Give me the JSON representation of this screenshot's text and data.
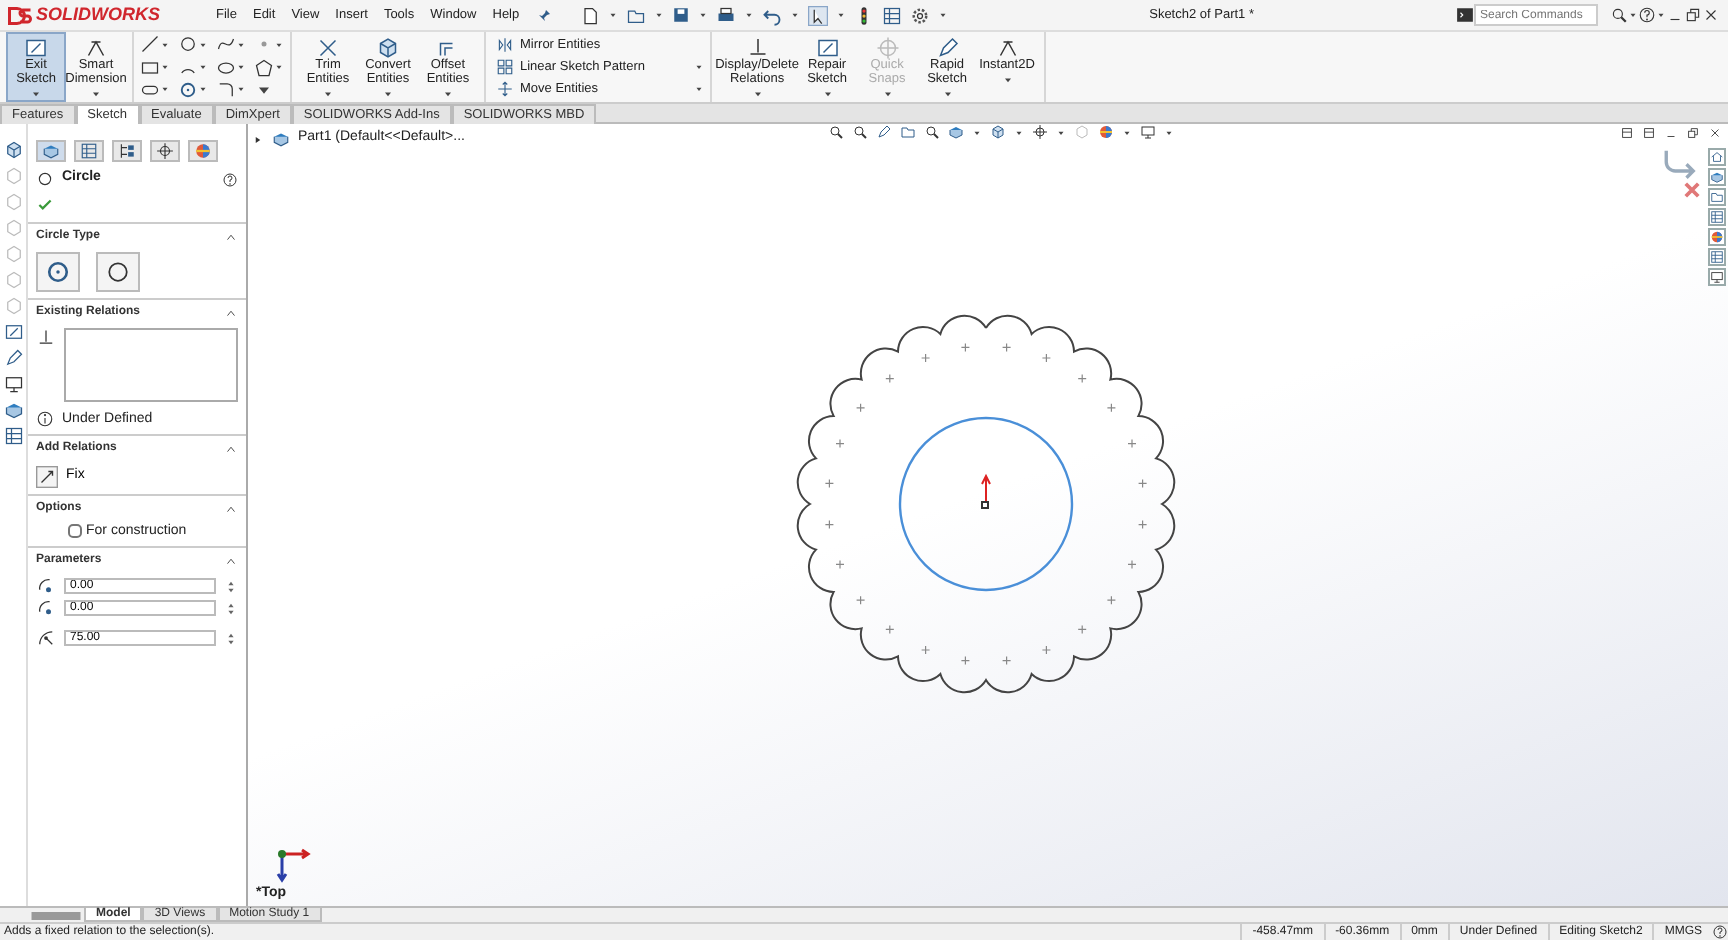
{
  "title_bar": {
    "logo": "SOLIDWORKS",
    "menus": [
      "File",
      "Edit",
      "View",
      "Insert",
      "Tools",
      "Window",
      "Help"
    ],
    "document_title": "Sketch2 of Part1 *",
    "search": {
      "placeholder": "Search Commands"
    }
  },
  "ribbon": {
    "left": [
      {
        "label": "Exit Sketch",
        "selected": true,
        "disabled": false
      },
      {
        "label": "Smart Dimension",
        "selected": false,
        "disabled": false
      }
    ],
    "middle": [
      {
        "label": "Trim Entities",
        "selected": false,
        "disabled": false
      },
      {
        "label": "Convert Entities",
        "selected": false,
        "disabled": false
      },
      {
        "label": "Offset Entities",
        "selected": false,
        "disabled": false
      }
    ],
    "stack": [
      "Mirror Entities",
      "Linear Sketch Pattern",
      "Move Entities"
    ],
    "right": [
      {
        "label": "Display/Delete Relations",
        "selected": false,
        "disabled": false
      },
      {
        "label": "Repair Sketch",
        "selected": false,
        "disabled": false
      },
      {
        "label": "Quick Snaps",
        "selected": false,
        "disabled": true
      },
      {
        "label": "Rapid Sketch",
        "selected": false,
        "disabled": false
      },
      {
        "label": "Instant2D",
        "selected": false,
        "disabled": false
      }
    ]
  },
  "command_tabs": [
    {
      "label": "Features",
      "selected": false
    },
    {
      "label": "Sketch",
      "selected": true
    },
    {
      "label": "Evaluate",
      "selected": false
    },
    {
      "label": "DimXpert",
      "selected": false
    },
    {
      "label": "SOLIDWORKS Add-Ins",
      "selected": false
    },
    {
      "label": "SOLIDWORKS MBD",
      "selected": false
    }
  ],
  "property_manager": {
    "tabs": [
      {
        "selected": true
      },
      {
        "selected": false
      },
      {
        "selected": false
      },
      {
        "selected": false
      },
      {
        "selected": false
      }
    ],
    "title": "Circle",
    "circle_type": {
      "title": "Circle Type"
    },
    "existing_relations": {
      "title": "Existing Relations",
      "status": "Under Defined"
    },
    "add_relations": {
      "title": "Add Relations",
      "items": [
        "Fix"
      ]
    },
    "options": {
      "title": "Options",
      "for_construction": {
        "label": "For construction",
        "checked": false
      }
    },
    "parameters": {
      "title": "Parameters",
      "fields": [
        {
          "value": "0.00"
        },
        {
          "value": "0.00"
        },
        {
          "value": "75.00"
        }
      ]
    }
  },
  "canvas": {
    "tree_item": "Part1 (Default<<Default>...",
    "view_name": "*Top"
  },
  "bottom_tabs": [
    {
      "label": "Model",
      "selected": true
    },
    {
      "label": "3D Views",
      "selected": false
    },
    {
      "label": "Motion Study 1",
      "selected": false
    }
  ],
  "status_bar": {
    "message": "Adds a fixed relation to the selection(s).",
    "fields": [
      "-458.47mm",
      "-60.36mm",
      "0mm",
      "Under Defined",
      "Editing Sketch2",
      "MMGS"
    ]
  }
}
